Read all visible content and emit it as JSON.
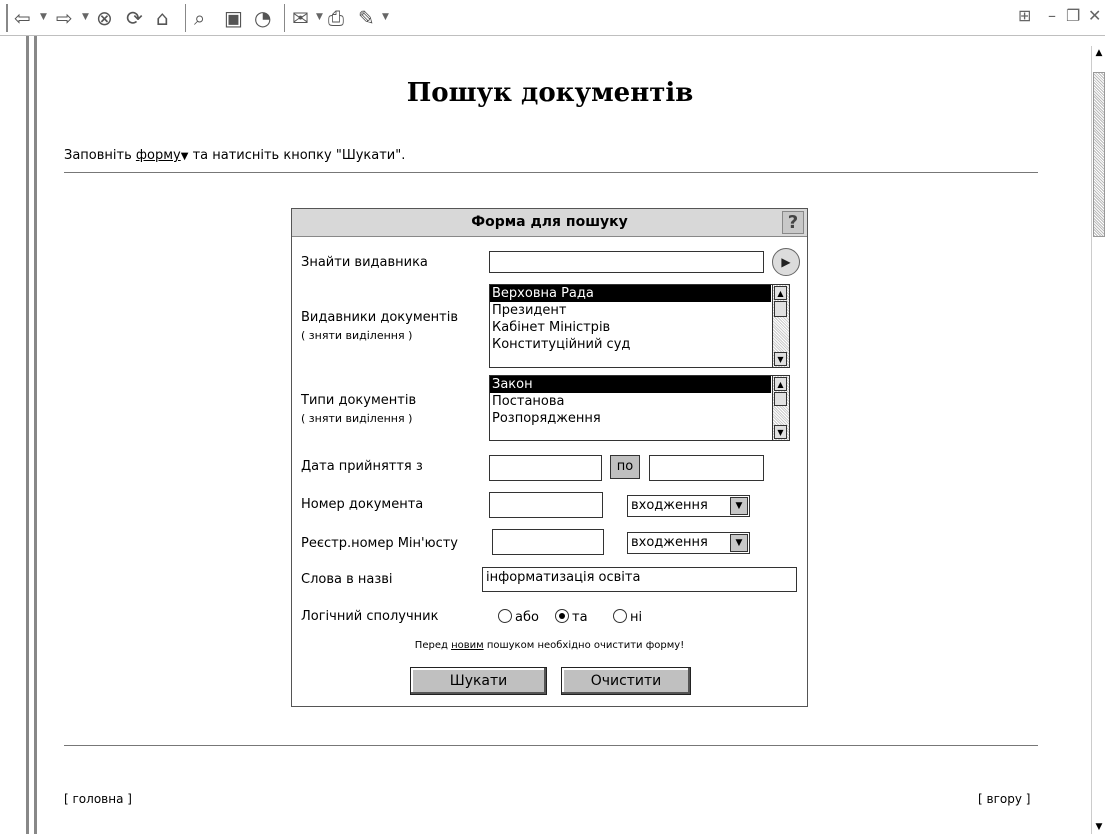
{
  "toolbar": {
    "icons": [
      "back-icon",
      "forward-icon",
      "stop-icon",
      "refresh-icon",
      "home-icon",
      "search-icon",
      "favorites-icon",
      "history-icon",
      "mail-icon",
      "print-icon",
      "edit-icon"
    ],
    "window_controls": [
      "windows-logo-icon",
      "minimize-icon",
      "restore-icon",
      "close-icon"
    ]
  },
  "page": {
    "title": "Пошук документів",
    "intro_prefix": "Заповніть ",
    "intro_link": "форму",
    "intro_suffix": " та натисніть кнопку \"Шукати\"."
  },
  "form": {
    "header": "Форма для пошуку",
    "help_label": "?",
    "find_publisher_label": "Знайти видавника",
    "find_publisher_value": "",
    "publishers_label": "Видавники документів",
    "publishers_clear": "( зняти виділення )",
    "publishers": [
      "Верховна Рада",
      "Президент",
      "Кабінет Міністрів",
      "Конституційний суд"
    ],
    "publishers_selected": "Верховна Рада",
    "types_label": "Типи документів",
    "types_clear": "( зняти виділення )",
    "types": [
      "Закон",
      "Постанова",
      "Розпорядження"
    ],
    "types_selected": "Закон",
    "date_label": "Дата прийняття з",
    "date_from": "",
    "date_to_label": "по",
    "date_to": "",
    "doc_number_label": "Номер документа",
    "doc_number_value": "",
    "doc_number_mode": "входження",
    "reg_number_label": "Реєстр.номер Мін'юсту",
    "reg_number_value": "",
    "reg_number_mode": "входження",
    "title_words_label": "Слова в назві",
    "title_words_value": "інформатизація освіта",
    "logic_label": "Логічний сполучник",
    "logic_options": [
      "або",
      "та",
      "ні"
    ],
    "logic_selected": "та",
    "note_prefix": "Перед ",
    "note_link": "новим",
    "note_suffix": " пошуком необхідно очистити форму!",
    "search_button": "Шукати",
    "clear_button": "Очистити"
  },
  "footer": {
    "home": "[ головна ]",
    "top": "[ вгору ]"
  }
}
